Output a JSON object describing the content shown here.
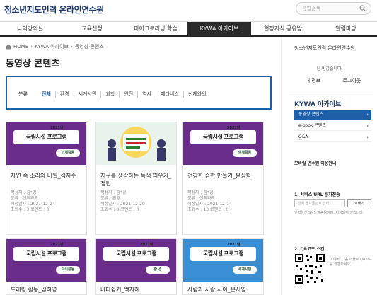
{
  "header": {
    "logo": "청소년지도인력 온라인연수원",
    "search_placeholder": "통합검색"
  },
  "nav": {
    "items": [
      {
        "label": "나의강의실",
        "active": false
      },
      {
        "label": "교육신청",
        "active": false
      },
      {
        "label": "마이크로러닝 학습",
        "active": false
      },
      {
        "label": "KYWA 아카이브",
        "active": true
      },
      {
        "label": "현장지식 공유방",
        "active": false
      },
      {
        "label": "알림마당",
        "active": false
      }
    ]
  },
  "breadcrumb": {
    "home": "HOME",
    "level1": "KYWA 아카이브",
    "level2": "동영상 콘텐츠"
  },
  "page_title": "동영상 콘텐츠",
  "filter": {
    "label": "분류",
    "options": [
      "전체",
      "환경",
      "세계시민",
      "과학",
      "안전",
      "역사",
      "메타버스",
      "신체와의"
    ]
  },
  "cards": [
    {
      "thumb": "purple",
      "year": "2021년",
      "banner": "국립시설 프로그램",
      "tag": "인체활동",
      "title": "자연 속 소리의 비밀_김지수",
      "meta": [
        "작성자 : 김*경",
        "분류 : 신체와의",
        "작성일자 : 2021-12-24",
        "조회수 : 3   코멘트 : 0"
      ]
    },
    {
      "thumb": "green",
      "year": "",
      "banner": "",
      "tag": "",
      "title": "지구를 생각하는 녹색 띄우기_정린",
      "meta": [
        "작성자 : 김*경",
        "분류 : 환경",
        "작성일자 : 2021-12-20",
        "조회수 : 8   코멘트 : 0"
      ]
    },
    {
      "thumb": "purple",
      "year": "2021년",
      "banner": "국립시설 프로그램",
      "tag": "인체활동",
      "title": "건강한 습관 만들기_윤상혁",
      "meta": [
        "작성자 : 김*경",
        "분류 : 신체와의",
        "작성일자 : 2021-12-14",
        "조회수 : 13   코멘트 : 0"
      ]
    },
    {
      "thumb": "purple",
      "year": "2021년",
      "banner": "국립시설 프로그램",
      "tag": "아리활동",
      "title": "드래킹 활동_김하영",
      "meta": []
    },
    {
      "thumb": "purple",
      "year": "2021년",
      "banner": "국립시설 프로그램",
      "tag": "환 경",
      "title": "바다쉼기_백지혜",
      "meta": []
    },
    {
      "thumb": "blue",
      "year": "2021년",
      "banner": "국립시설 프로그램",
      "tag": "세계시민",
      "title": "사람과 사람 사이_운서영",
      "meta": []
    }
  ],
  "sidebar": {
    "org": "청소년지도인력 온라인연수원",
    "greeting": "님 반갑습니다.",
    "links": [
      "내 정보",
      "로그아웃"
    ],
    "section_title": "KYWA 아카이브",
    "menu": [
      {
        "label": "동영상 콘텐츠",
        "active": true
      },
      {
        "label": "e-book 콘텐츠",
        "active": false
      },
      {
        "label": "Q&A",
        "active": false
      }
    ],
    "mobile_title": "모바일 연수원 이용안내",
    "step1": "1. 서비스 URL 문자전송",
    "phone_placeholder": "-없이 핸드폰번호 입력",
    "send_button": "보내기",
    "note1": "인력하신 SMS 발송용이며, 저장되지 않습니다.",
    "step2": "2. QR코드 스캔",
    "note2": "네이버, 다음 어플로 QR코드를 촬영하세요."
  },
  "colors": {
    "accent": "#1e5fa8",
    "nav_active": "#2b2b2b",
    "thumb_purple": "#6b2d8c"
  }
}
